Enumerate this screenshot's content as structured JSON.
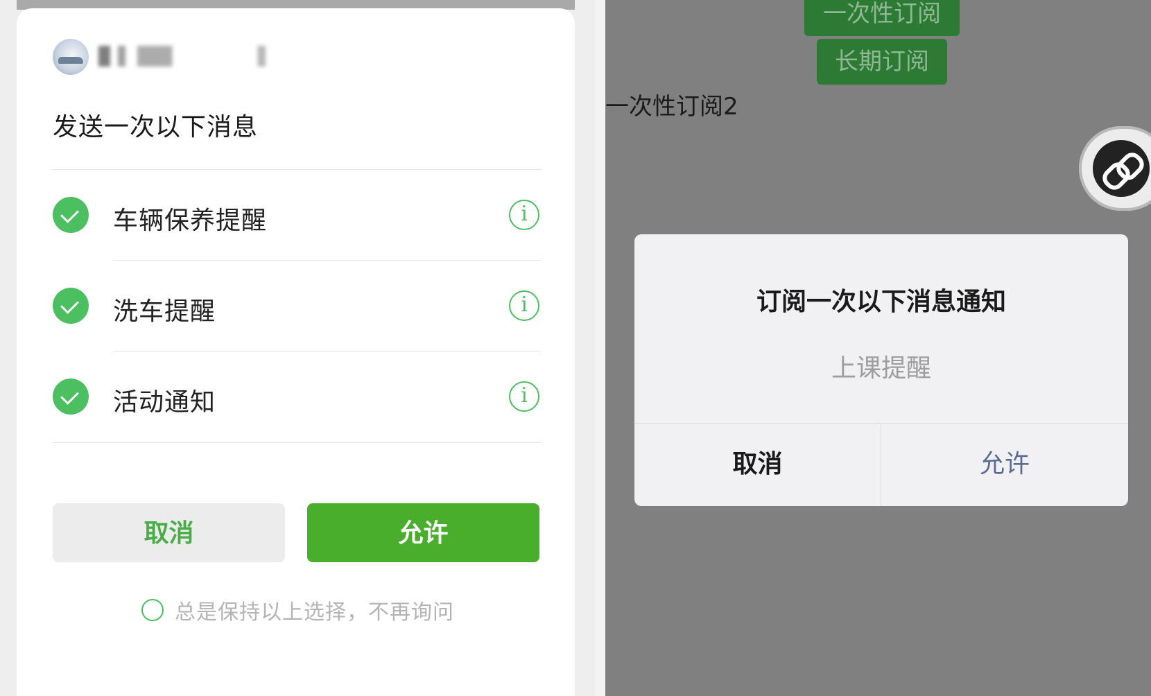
{
  "left": {
    "sheet": {
      "title": "发送一次以下消息",
      "items": [
        {
          "label": "车辆保养提醒",
          "checked": true
        },
        {
          "label": "洗车提醒",
          "checked": true
        },
        {
          "label": "活动通知",
          "checked": true
        }
      ],
      "info_icon_glyph": "i",
      "cancel_label": "取消",
      "allow_label": "允许",
      "remember_label": "总是保持以上选择，不再询问"
    }
  },
  "right": {
    "page": {
      "buttons": [
        "一次性订阅",
        "长期订阅"
      ],
      "text": "一次性订阅2"
    },
    "dialog": {
      "title": "订阅一次以下消息通知",
      "subtitle": "上课提醒",
      "cancel_label": "取消",
      "allow_label": "允许"
    }
  },
  "colors": {
    "accent_green": "#4cbf61",
    "allow_button": "#48ae2c",
    "dialog_allow_text": "#5a6c95",
    "overlay": "#808080"
  }
}
